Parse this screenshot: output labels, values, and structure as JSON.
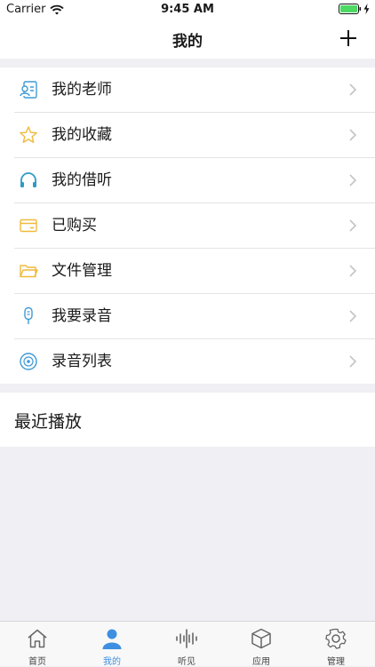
{
  "status_bar": {
    "carrier": "Carrier",
    "time": "9:45 AM"
  },
  "nav": {
    "title": "我的",
    "add_icon": "plus-icon"
  },
  "menu": [
    {
      "label": "我的老师",
      "icon": "teacher-card-icon"
    },
    {
      "label": "我的收藏",
      "icon": "star-icon"
    },
    {
      "label": "我的借听",
      "icon": "headphones-icon"
    },
    {
      "label": "已购买",
      "icon": "card-icon"
    },
    {
      "label": "文件管理",
      "icon": "folder-icon"
    },
    {
      "label": "我要录音",
      "icon": "microphone-icon"
    },
    {
      "label": "录音列表",
      "icon": "disc-icon"
    }
  ],
  "recent": {
    "title": "最近播放"
  },
  "tabs": [
    {
      "label": "首页",
      "icon": "home-icon",
      "active": false
    },
    {
      "label": "我的",
      "icon": "person-icon",
      "active": true
    },
    {
      "label": "听见",
      "icon": "soundwave-icon",
      "active": false
    },
    {
      "label": "应用",
      "icon": "cube-icon",
      "active": false
    },
    {
      "label": "管理",
      "icon": "gear-icon",
      "active": false
    }
  ],
  "colors": {
    "active_tab": "#3e8fe1",
    "icon_blue": "#3f9ad7",
    "icon_yellow": "#f0b93a",
    "background": "#efeff4"
  }
}
